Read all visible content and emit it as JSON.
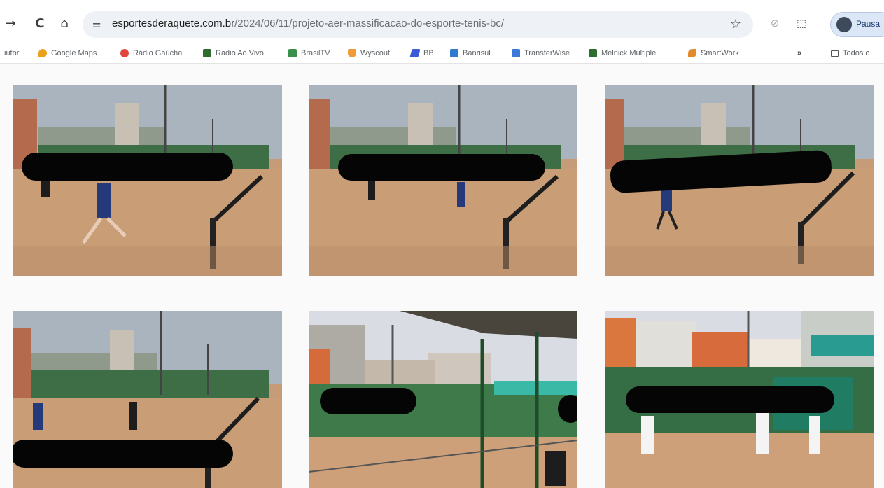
{
  "toolbar": {
    "back_icon": "→",
    "reload_icon": "C",
    "home_icon": "⌂",
    "site_info_icon": "⚌",
    "url_host": "esportesderaquete.com.br",
    "url_path": "/2024/06/11/projeto-aer-massificacao-do-esporte-tenis-bc/",
    "bookmark_icon": "☆",
    "extension_icon": "⊘",
    "puzzle_icon": "⬚",
    "profile_name": "Pausa"
  },
  "bookmarks": {
    "items": [
      {
        "label": "iutor",
        "color": "#ffffff"
      },
      {
        "label": "Google Maps",
        "color": "#e9a21a"
      },
      {
        "label": "Rádio Gaúcha",
        "color": "#e0463a"
      },
      {
        "label": "Rádio Ao Vivo",
        "color": "#2f6d2f"
      },
      {
        "label": "BrasilTV",
        "color": "#3a8f4a"
      },
      {
        "label": "Wyscout",
        "color": "#f29b38"
      },
      {
        "label": "BB",
        "color": "#3a5ad6"
      },
      {
        "label": "Banrisul",
        "color": "#2e7bd1"
      },
      {
        "label": "TransferWise",
        "color": "#3b7ad8"
      },
      {
        "label": "Melnick Multiple",
        "color": "#2d6e2d"
      },
      {
        "label": "SmartWork",
        "color": "#e58a2c"
      }
    ],
    "more": "»",
    "all_label": "Todos o"
  },
  "gallery": {
    "photos": [
      {
        "caption": ""
      },
      {
        "caption": ""
      },
      {
        "caption": ""
      },
      {
        "caption": ""
      },
      {
        "caption": ""
      },
      {
        "caption": ""
      }
    ]
  }
}
